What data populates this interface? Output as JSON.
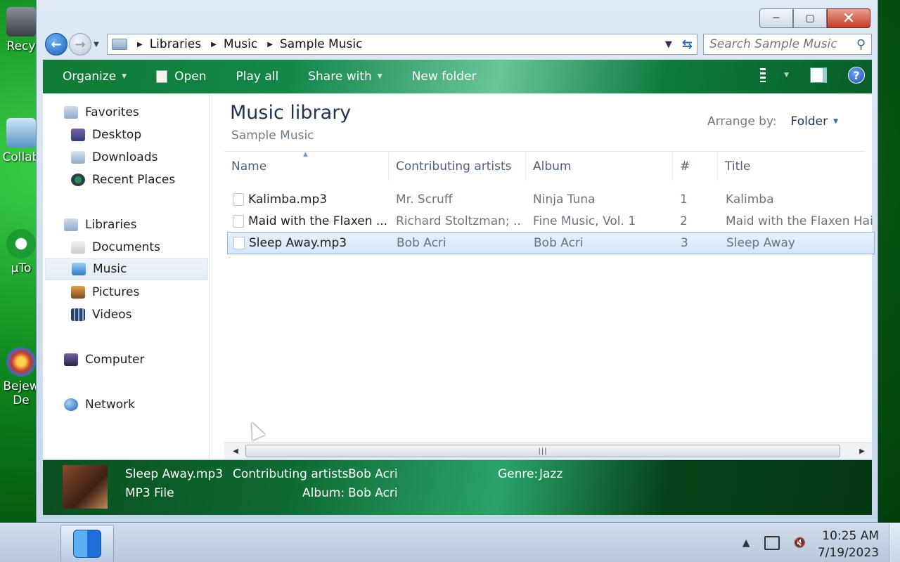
{
  "desktop": {
    "icons": [
      {
        "label": "Recy",
        "color": "#5a5f66"
      },
      {
        "label": "Collab",
        "color": "#7bb3d9"
      },
      {
        "label": "µTo",
        "color": "#23a33a"
      },
      {
        "label": "Bejew",
        "label2": "De",
        "color": "#c43b2b"
      }
    ]
  },
  "window": {
    "nav": {
      "breadcrumb": [
        "Libraries",
        "Music",
        "Sample Music"
      ],
      "search_placeholder": "Search Sample Music"
    },
    "toolbar": {
      "organize": "Organize",
      "open": "Open",
      "play_all": "Play all",
      "share_with": "Share with",
      "new_folder": "New folder"
    },
    "nav_pane": {
      "favorites": "Favorites",
      "favorites_items": [
        "Desktop",
        "Downloads",
        "Recent Places"
      ],
      "libraries": "Libraries",
      "libraries_items": [
        "Documents",
        "Music",
        "Pictures",
        "Videos"
      ],
      "selected": "Music",
      "computer": "Computer",
      "network": "Network"
    },
    "main": {
      "title": "Music library",
      "subtitle": "Sample Music",
      "arrange_label": "Arrange by:",
      "arrange_value": "Folder",
      "columns": [
        "Name",
        "Contributing artists",
        "Album",
        "#",
        "Title"
      ],
      "rows": [
        {
          "name": "Kalimba.mp3",
          "artists": "Mr. Scruff",
          "album": "Ninja Tuna",
          "num": "1",
          "title": "Kalimba"
        },
        {
          "name": "Maid with the Flaxen ...",
          "artists": "Richard Stoltzman; ...",
          "album": "Fine Music, Vol. 1",
          "num": "2",
          "title": "Maid with the Flaxen Hair"
        },
        {
          "name": "Sleep Away.mp3",
          "artists": "Bob Acri",
          "album": "Bob Acri",
          "num": "3",
          "title": "Sleep Away"
        }
      ],
      "selected_row": 2
    },
    "details": {
      "filename": "Sleep Away.mp3",
      "filetype": "MP3 File",
      "artists_label": "Contributing artists:",
      "artists_value": "Bob Acri",
      "album_label": "Album:",
      "album_value": "Bob Acri",
      "genre_label": "Genre:",
      "genre_value": "Jazz"
    }
  },
  "taskbar": {
    "time": "10:25 AM",
    "date": "7/19/2023"
  },
  "colors": {
    "toolbar_green": "#0f7a33",
    "selection_blue": "#d4e5f9",
    "title_blue": "#1e3550"
  }
}
